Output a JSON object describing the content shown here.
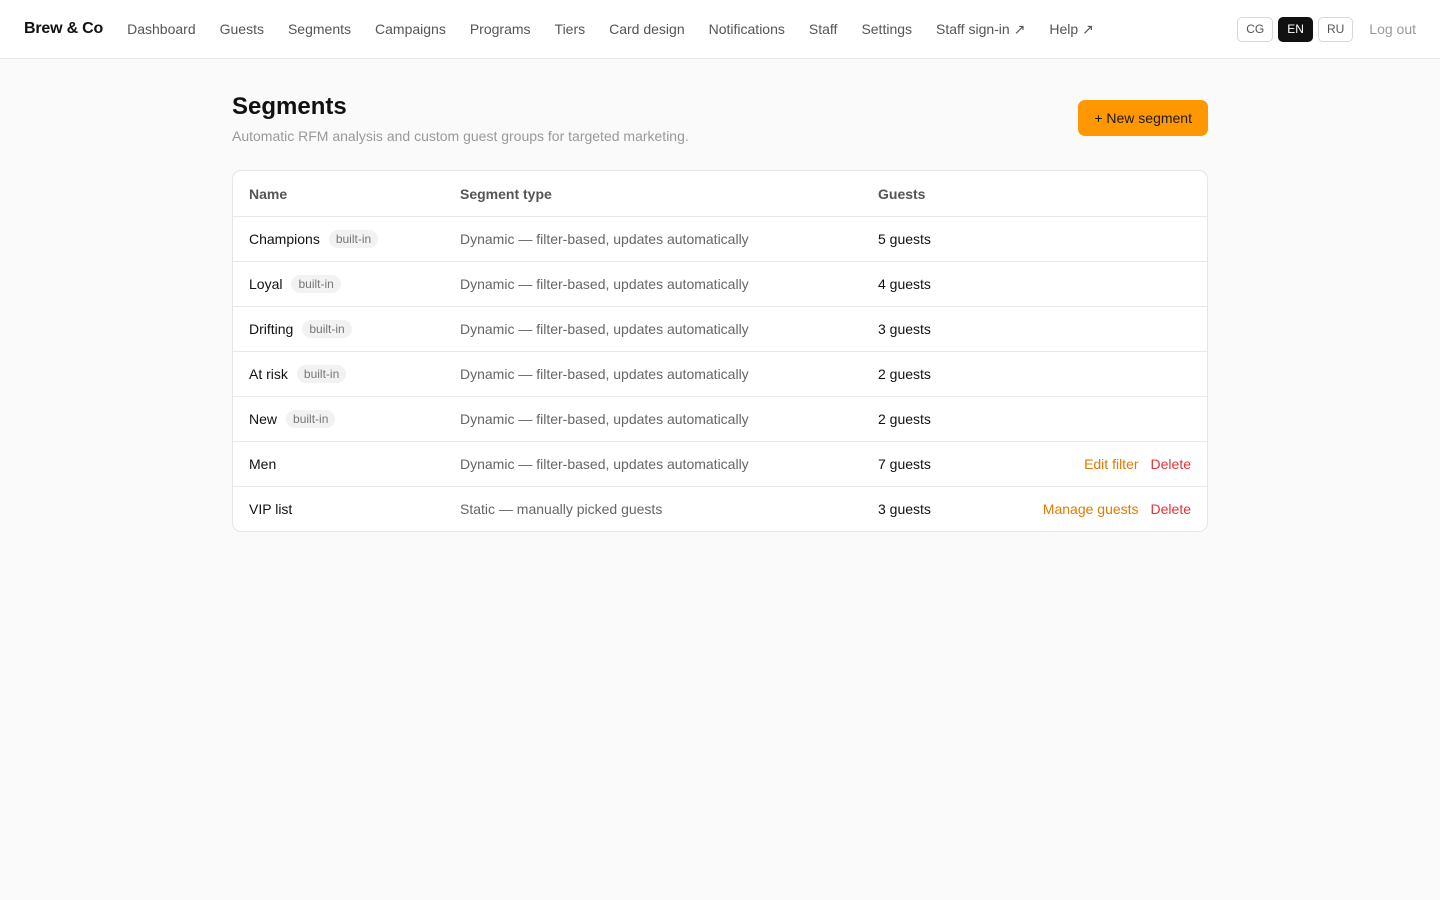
{
  "brand": "Brew & Co",
  "nav": [
    {
      "label": "Dashboard"
    },
    {
      "label": "Guests"
    },
    {
      "label": "Segments"
    },
    {
      "label": "Campaigns"
    },
    {
      "label": "Programs"
    },
    {
      "label": "Tiers"
    },
    {
      "label": "Card design"
    },
    {
      "label": "Notifications"
    },
    {
      "label": "Staff"
    },
    {
      "label": "Settings"
    },
    {
      "label": "Staff sign-in ↗"
    },
    {
      "label": "Help ↗"
    }
  ],
  "languages": [
    {
      "code": "CG",
      "active": false
    },
    {
      "code": "EN",
      "active": true
    },
    {
      "code": "RU",
      "active": false
    }
  ],
  "logout_label": "Log out",
  "page": {
    "title": "Segments",
    "subtitle": "Automatic RFM analysis and custom guest groups for targeted marketing.",
    "new_button": "+ New segment"
  },
  "table": {
    "columns": [
      "Name",
      "Segment type",
      "Guests"
    ],
    "rows": [
      {
        "name": "Champions",
        "badge": "built-in",
        "type": "Dynamic — filter-based, updates automatically",
        "guests": "5 guests",
        "actions": []
      },
      {
        "name": "Loyal",
        "badge": "built-in",
        "type": "Dynamic — filter-based, updates automatically",
        "guests": "4 guests",
        "actions": []
      },
      {
        "name": "Drifting",
        "badge": "built-in",
        "type": "Dynamic — filter-based, updates automatically",
        "guests": "3 guests",
        "actions": []
      },
      {
        "name": "At risk",
        "badge": "built-in",
        "type": "Dynamic — filter-based, updates automatically",
        "guests": "2 guests",
        "actions": []
      },
      {
        "name": "New",
        "badge": "built-in",
        "type": "Dynamic — filter-based, updates automatically",
        "guests": "2 guests",
        "actions": []
      },
      {
        "name": "Men",
        "badge": "",
        "type": "Dynamic — filter-based, updates automatically",
        "guests": "7 guests",
        "actions": [
          {
            "label": "Edit filter",
            "kind": "edit"
          },
          {
            "label": "Delete",
            "kind": "delete"
          }
        ]
      },
      {
        "name": "VIP list",
        "badge": "",
        "type": "Static — manually picked guests",
        "guests": "3 guests",
        "actions": [
          {
            "label": "Manage guests",
            "kind": "edit"
          },
          {
            "label": "Delete",
            "kind": "delete"
          }
        ]
      }
    ]
  },
  "colors": {
    "accent": "#ff9800",
    "action_link": "#e07b00",
    "danger": "#e5333a",
    "active_lang_bg": "#111111"
  }
}
